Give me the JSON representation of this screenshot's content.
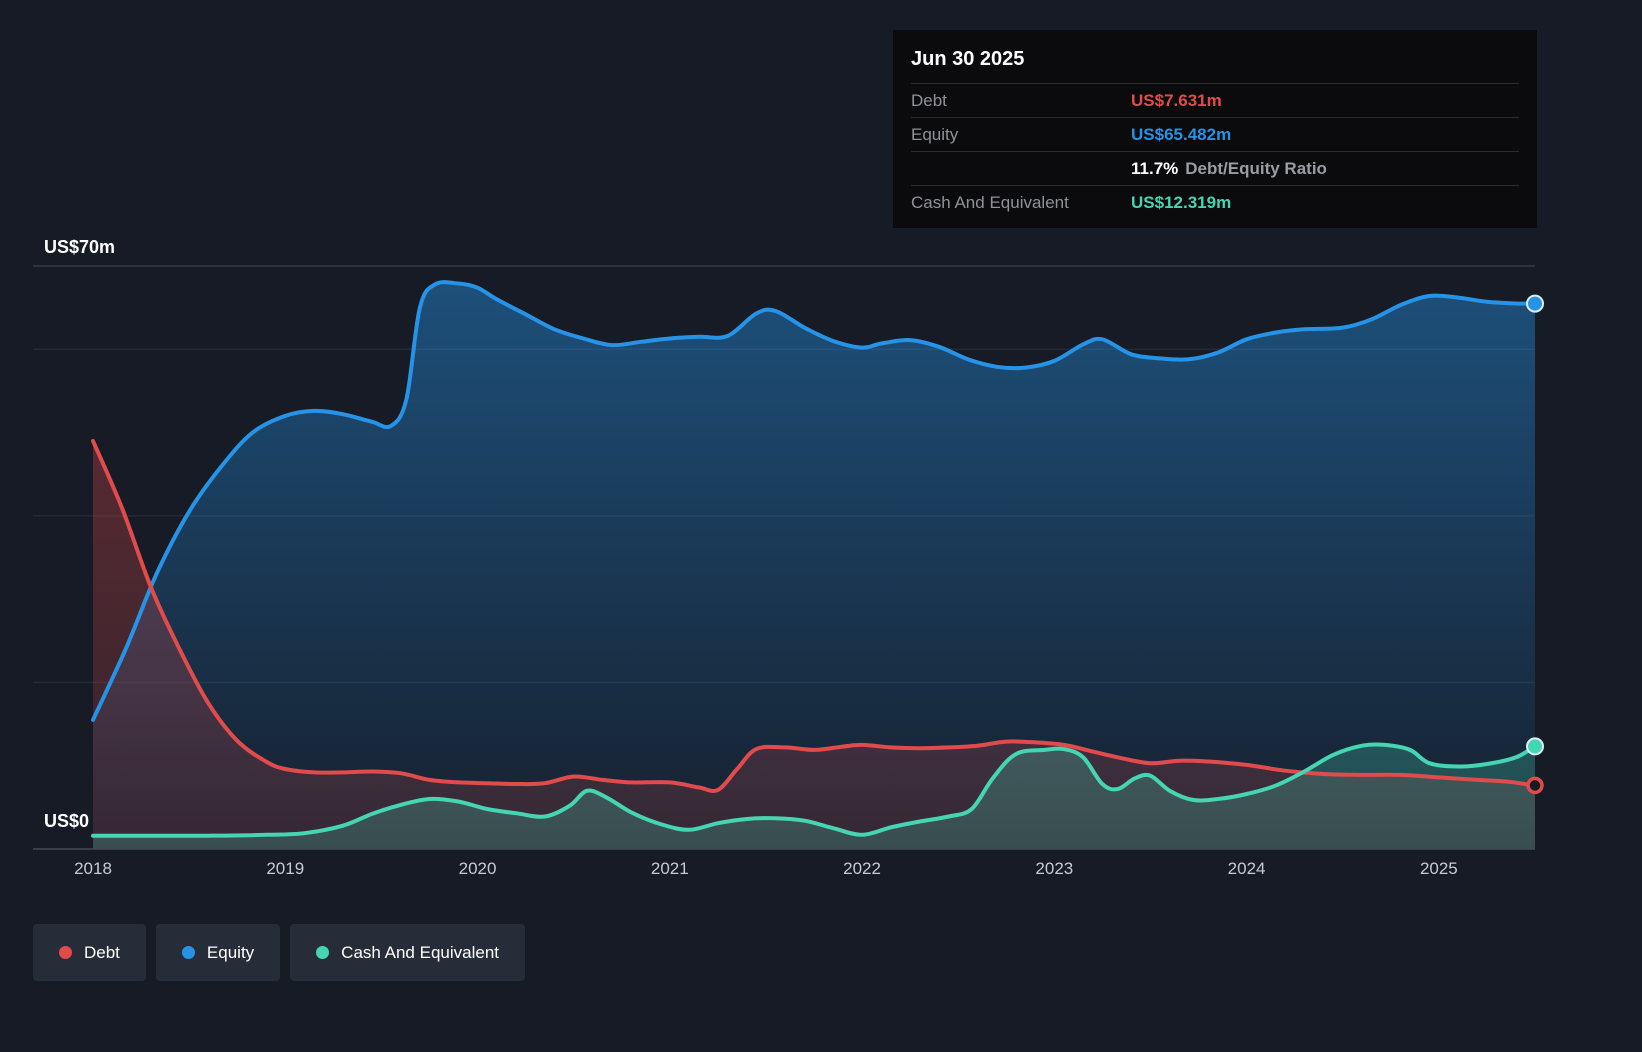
{
  "colors": {
    "debt": "#e14b4b",
    "equity": "#2693e6",
    "cash": "#45d5b2",
    "background": "#161b26"
  },
  "tooltip": {
    "date": "Jun 30 2025",
    "rows": {
      "debt": {
        "label": "Debt",
        "value": "US$7.631m"
      },
      "equity": {
        "label": "Equity",
        "value": "US$65.482m"
      },
      "ratio": {
        "value": "11.7%",
        "label": "Debt/Equity Ratio"
      },
      "cash": {
        "label": "Cash And Equivalent",
        "value": "US$12.319m"
      }
    }
  },
  "legend": {
    "items": [
      {
        "label": "Debt",
        "color": "#e14b4b"
      },
      {
        "label": "Equity",
        "color": "#2693e6"
      },
      {
        "label": "Cash And Equivalent",
        "color": "#45d5b2"
      }
    ]
  },
  "chart_data": {
    "type": "area",
    "y_axis": {
      "top_label": "US$70m",
      "bottom_label": "US$0"
    },
    "x_domain": [
      2018,
      2025.5
    ],
    "y_domain": [
      0,
      70
    ],
    "y_gridlines": [
      0,
      20,
      40,
      60,
      70
    ],
    "x_ticks": [
      2018,
      2019,
      2020,
      2021,
      2022,
      2023,
      2024,
      2025
    ],
    "x_tick_labels": [
      "2018",
      "2019",
      "2020",
      "2021",
      "2022",
      "2023",
      "2024",
      "2025"
    ],
    "series": [
      {
        "name": "Equity",
        "color": "#2693e6",
        "marker": "dot",
        "fill_stops": [
          [
            0,
            0.45
          ],
          [
            1,
            0.04
          ]
        ],
        "points": [
          [
            2018,
            15.5
          ],
          [
            2018.17,
            24
          ],
          [
            2018.33,
            33
          ],
          [
            2018.5,
            40.5
          ],
          [
            2018.67,
            46
          ],
          [
            2018.83,
            50
          ],
          [
            2019,
            52
          ],
          [
            2019.15,
            52.6
          ],
          [
            2019.3,
            52.2
          ],
          [
            2019.45,
            51.3
          ],
          [
            2019.55,
            50.8
          ],
          [
            2019.63,
            54
          ],
          [
            2019.7,
            65
          ],
          [
            2019.78,
            67.8
          ],
          [
            2019.9,
            67.9
          ],
          [
            2020,
            67.4
          ],
          [
            2020.1,
            66
          ],
          [
            2020.25,
            64.2
          ],
          [
            2020.4,
            62.4
          ],
          [
            2020.55,
            61.3
          ],
          [
            2020.7,
            60.5
          ],
          [
            2020.85,
            60.9
          ],
          [
            2021,
            61.3
          ],
          [
            2021.15,
            61.5
          ],
          [
            2021.3,
            61.6
          ],
          [
            2021.45,
            64.3
          ],
          [
            2021.55,
            64.6
          ],
          [
            2021.7,
            62.6
          ],
          [
            2021.85,
            61
          ],
          [
            2022,
            60.2
          ],
          [
            2022.1,
            60.7
          ],
          [
            2022.25,
            61.1
          ],
          [
            2022.4,
            60.3
          ],
          [
            2022.55,
            58.8
          ],
          [
            2022.7,
            57.9
          ],
          [
            2022.85,
            57.8
          ],
          [
            2023,
            58.6
          ],
          [
            2023.15,
            60.6
          ],
          [
            2023.25,
            61.2
          ],
          [
            2023.4,
            59.4
          ],
          [
            2023.55,
            58.9
          ],
          [
            2023.7,
            58.8
          ],
          [
            2023.85,
            59.6
          ],
          [
            2024,
            61.2
          ],
          [
            2024.15,
            62
          ],
          [
            2024.3,
            62.4
          ],
          [
            2024.5,
            62.6
          ],
          [
            2024.65,
            63.6
          ],
          [
            2024.8,
            65.3
          ],
          [
            2024.95,
            66.4
          ],
          [
            2025.1,
            66.2
          ],
          [
            2025.25,
            65.7
          ],
          [
            2025.4,
            65.5
          ],
          [
            2025.5,
            65.482
          ]
        ]
      },
      {
        "name": "Debt",
        "color": "#e14b4b",
        "marker": "ring",
        "fill_stops": [
          [
            0,
            0.6
          ],
          [
            0.3,
            0.32
          ],
          [
            1,
            0.15
          ]
        ],
        "points": [
          [
            2018,
            49
          ],
          [
            2018.15,
            41
          ],
          [
            2018.3,
            31.5
          ],
          [
            2018.45,
            24
          ],
          [
            2018.6,
            17.5
          ],
          [
            2018.75,
            13
          ],
          [
            2018.9,
            10.5
          ],
          [
            2019,
            9.6
          ],
          [
            2019.15,
            9.2
          ],
          [
            2019.3,
            9.2
          ],
          [
            2019.45,
            9.3
          ],
          [
            2019.6,
            9.1
          ],
          [
            2019.75,
            8.3
          ],
          [
            2019.9,
            8
          ],
          [
            2020.05,
            7.9
          ],
          [
            2020.2,
            7.8
          ],
          [
            2020.35,
            7.9
          ],
          [
            2020.5,
            8.7
          ],
          [
            2020.65,
            8.3
          ],
          [
            2020.8,
            8
          ],
          [
            2021,
            8
          ],
          [
            2021.15,
            7.4
          ],
          [
            2021.25,
            7.1
          ],
          [
            2021.35,
            9.6
          ],
          [
            2021.45,
            12
          ],
          [
            2021.6,
            12.2
          ],
          [
            2021.75,
            11.9
          ],
          [
            2021.9,
            12.3
          ],
          [
            2022,
            12.5
          ],
          [
            2022.15,
            12.2
          ],
          [
            2022.3,
            12.1
          ],
          [
            2022.45,
            12.2
          ],
          [
            2022.6,
            12.4
          ],
          [
            2022.75,
            12.9
          ],
          [
            2022.9,
            12.8
          ],
          [
            2023.05,
            12.5
          ],
          [
            2023.2,
            11.7
          ],
          [
            2023.35,
            10.9
          ],
          [
            2023.5,
            10.3
          ],
          [
            2023.65,
            10.6
          ],
          [
            2023.8,
            10.5
          ],
          [
            2024,
            10.1
          ],
          [
            2024.2,
            9.4
          ],
          [
            2024.4,
            9
          ],
          [
            2024.6,
            8.9
          ],
          [
            2024.8,
            8.9
          ],
          [
            2025,
            8.6
          ],
          [
            2025.2,
            8.3
          ],
          [
            2025.35,
            8.1
          ],
          [
            2025.5,
            7.631
          ]
        ]
      },
      {
        "name": "Cash And Equivalent",
        "color": "#45d5b2",
        "marker": "dot",
        "fill_stops": [
          [
            0,
            0.5
          ],
          [
            0.8,
            0.26
          ],
          [
            1,
            0.22
          ]
        ],
        "points": [
          [
            2018,
            1.6
          ],
          [
            2018.3,
            1.6
          ],
          [
            2018.6,
            1.6
          ],
          [
            2018.9,
            1.7
          ],
          [
            2019.1,
            1.9
          ],
          [
            2019.3,
            2.8
          ],
          [
            2019.45,
            4.2
          ],
          [
            2019.6,
            5.3
          ],
          [
            2019.75,
            6
          ],
          [
            2019.9,
            5.7
          ],
          [
            2020.05,
            4.8
          ],
          [
            2020.2,
            4.3
          ],
          [
            2020.35,
            3.9
          ],
          [
            2020.48,
            5.2
          ],
          [
            2020.57,
            7
          ],
          [
            2020.67,
            6.2
          ],
          [
            2020.8,
            4.4
          ],
          [
            2020.95,
            3
          ],
          [
            2021.1,
            2.3
          ],
          [
            2021.25,
            3.1
          ],
          [
            2021.4,
            3.6
          ],
          [
            2021.55,
            3.7
          ],
          [
            2021.7,
            3.4
          ],
          [
            2021.85,
            2.5
          ],
          [
            2022,
            1.7
          ],
          [
            2022.15,
            2.6
          ],
          [
            2022.3,
            3.3
          ],
          [
            2022.45,
            3.9
          ],
          [
            2022.57,
            4.8
          ],
          [
            2022.68,
            8.5
          ],
          [
            2022.8,
            11.4
          ],
          [
            2022.95,
            11.9
          ],
          [
            2023.05,
            12
          ],
          [
            2023.15,
            11
          ],
          [
            2023.25,
            7.8
          ],
          [
            2023.33,
            7.2
          ],
          [
            2023.42,
            8.5
          ],
          [
            2023.5,
            8.8
          ],
          [
            2023.6,
            7
          ],
          [
            2023.72,
            5.9
          ],
          [
            2023.85,
            6
          ],
          [
            2024,
            6.6
          ],
          [
            2024.15,
            7.6
          ],
          [
            2024.3,
            9.3
          ],
          [
            2024.45,
            11.3
          ],
          [
            2024.6,
            12.4
          ],
          [
            2024.72,
            12.5
          ],
          [
            2024.85,
            11.9
          ],
          [
            2024.95,
            10.3
          ],
          [
            2025.1,
            9.9
          ],
          [
            2025.25,
            10.2
          ],
          [
            2025.4,
            11
          ],
          [
            2025.5,
            12.319
          ]
        ]
      }
    ]
  }
}
